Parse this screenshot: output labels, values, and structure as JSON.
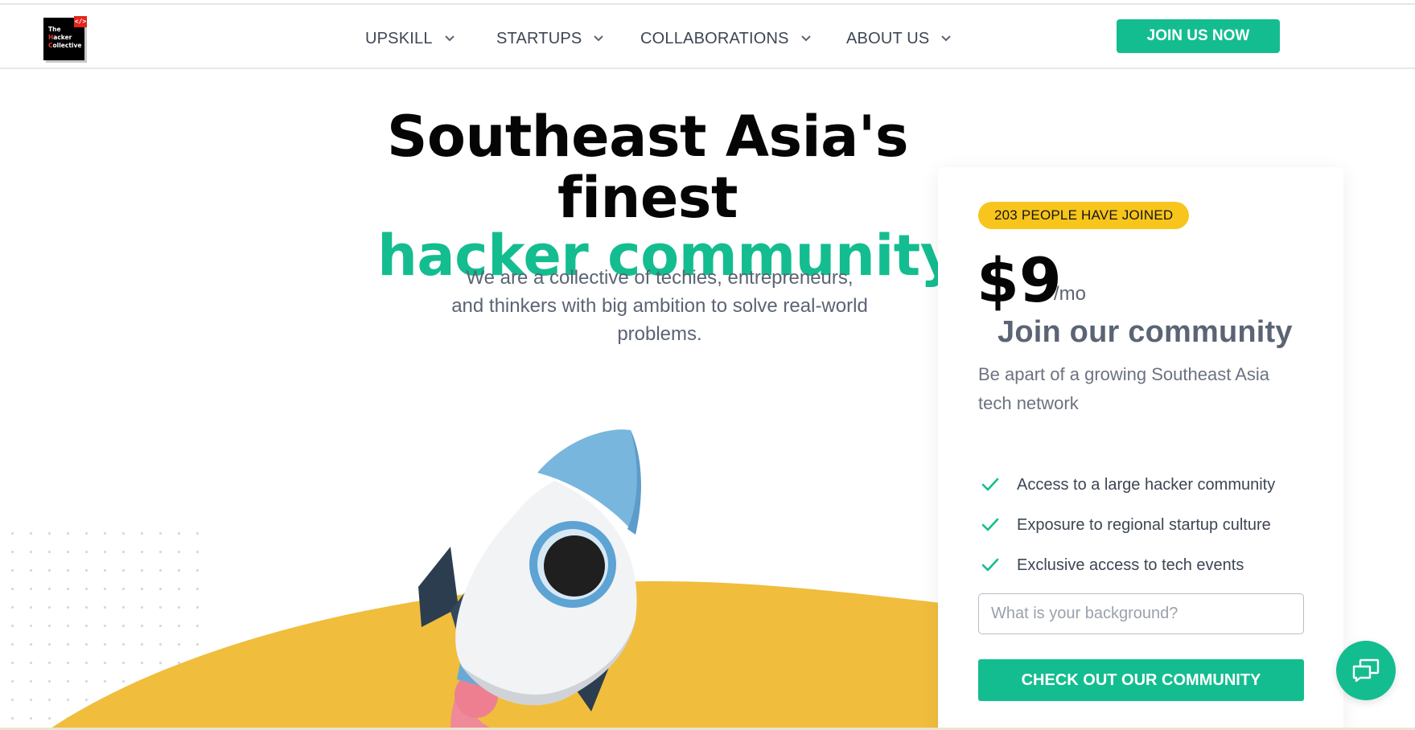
{
  "brand": {
    "logo_lines": [
      "The",
      "Hacker",
      "Collective"
    ],
    "logo_tag": "</>",
    "accent_color": "#14bd8f",
    "badge_color": "#f7c51c",
    "hill_color": "#f0bd3d"
  },
  "nav": {
    "items": [
      {
        "label": "UPSKILL"
      },
      {
        "label": "STARTUPS"
      },
      {
        "label": "COLLABORATIONS"
      },
      {
        "label": "ABOUT US"
      }
    ],
    "cta": "JOIN US NOW"
  },
  "hero": {
    "title_line1": "Southeast Asia's finest",
    "title_line2": "hacker community",
    "subtitle": "We are a collective of techies, entrepreneurs, and thinkers with big ambition to solve real-world problems."
  },
  "pricing": {
    "badge": "203 PEOPLE HAVE JOINED",
    "price": "$9",
    "period": "/mo",
    "title": "Join our community",
    "description": "Be apart of a growing Southeast Asia tech network",
    "features": [
      "Access to a large hacker community",
      "Exposure to regional startup culture",
      "Exclusive access to tech events"
    ],
    "input_placeholder": "What is your background?",
    "button": "CHECK OUT OUR COMMUNITY"
  },
  "icons": {
    "nav_chevron": "chevron-down-icon",
    "feature_check": "check-icon",
    "chat": "chat-bubble-icon"
  }
}
